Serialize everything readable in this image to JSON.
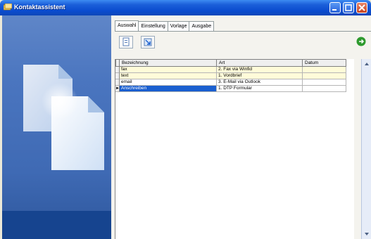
{
  "window": {
    "title": "Kontaktassistent"
  },
  "tabs": [
    {
      "label": "Auswahl",
      "active": true
    },
    {
      "label": "Einstellung",
      "active": false
    },
    {
      "label": "Vorlage",
      "active": false
    },
    {
      "label": "Ausgabe",
      "active": false
    }
  ],
  "toolbar": {
    "icons": [
      "new-icon",
      "import-icon"
    ],
    "go_icon": "go-arrow-icon"
  },
  "grid": {
    "columns": [
      "Bezeichnung",
      "Art",
      "Datum"
    ],
    "rows": [
      {
        "name": "fax",
        "art": "2. Fax via Winfid",
        "datum": ""
      },
      {
        "name": "text",
        "art": "1. Vordbrief",
        "datum": ""
      },
      {
        "name": "email",
        "art": "3. E-Mail via Outlook",
        "datum": ""
      },
      {
        "name": "Anschreiben",
        "art": "1. DTP Formular",
        "datum": "",
        "selected": true
      }
    ]
  },
  "colors": {
    "titlebar": "#0a4ccf",
    "left_panel": "#4a75bf",
    "selection": "#1a5fd0",
    "row_alt": "#fffbd9"
  }
}
